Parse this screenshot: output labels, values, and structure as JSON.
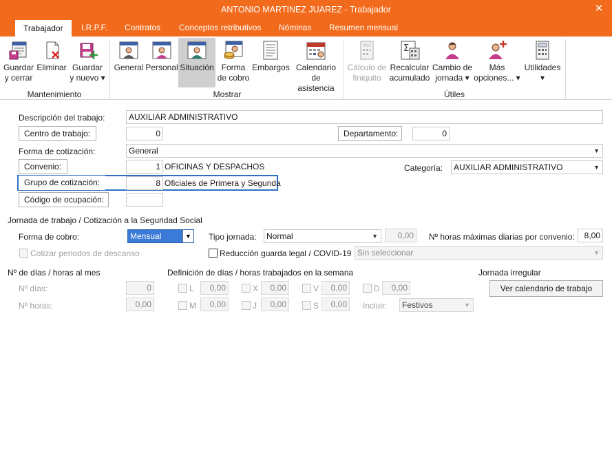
{
  "window": {
    "title": "ANTONIO MARTINEZ JUAREZ - Trabajador",
    "close_glyph": "✕"
  },
  "tabs": [
    "Trabajador",
    "I.R.P.F.",
    "Contratos",
    "Conceptos retributivos",
    "Nóminas",
    "Resumen mensual"
  ],
  "ribbon": {
    "buttons": [
      {
        "line1": "Guardar",
        "line2": "y cerrar",
        "icon": "save-close-icon"
      },
      {
        "line1": "Eliminar",
        "line2": "",
        "icon": "delete-icon"
      },
      {
        "line1": "Guardar",
        "line2": "y nuevo ▾",
        "icon": "save-new-icon"
      },
      {
        "line1": "General",
        "line2": "",
        "icon": "worker-general-icon"
      },
      {
        "line1": "Personal",
        "line2": "",
        "icon": "worker-personal-icon"
      },
      {
        "line1": "Situación",
        "line2": "",
        "icon": "worker-situation-icon"
      },
      {
        "line1": "Forma",
        "line2": "de cobro",
        "icon": "payment-method-icon"
      },
      {
        "line1": "Embargos",
        "line2": "",
        "icon": "seizures-icon"
      },
      {
        "line1": "Calendario",
        "line2": "de asistencia",
        "icon": "attendance-calendar-icon"
      },
      {
        "line1": "Cálculo de",
        "line2": "finiquito",
        "icon": "settlement-calc-icon"
      },
      {
        "line1": "Recalcular",
        "line2": "acumulado",
        "icon": "recalculate-icon"
      },
      {
        "line1": "Cambio de",
        "line2": "jornada ▾",
        "icon": "change-schedule-icon"
      },
      {
        "line1": "Más",
        "line2": "opciones... ▾",
        "icon": "more-options-icon"
      },
      {
        "line1": "Utilidades",
        "line2": "▾",
        "icon": "utilities-icon"
      }
    ],
    "groups": [
      "Mantenimiento",
      "Mostrar",
      "Útiles"
    ]
  },
  "form": {
    "descripcion_label": "Descripción del trabajo:",
    "descripcion_value": "AUXILIAR ADMINISTRATIVO",
    "centro_btn": "Centro de trabajo:",
    "centro_value": "0",
    "departamento_btn": "Departamento:",
    "departamento_value": "0",
    "forma_cot_label": "Forma de cotización:",
    "forma_cot_value": "General",
    "convenio_btn": "Convenio:",
    "convenio_code": "1",
    "convenio_name": "OFICINAS Y DESPACHOS",
    "categoria_label": "Categoría:",
    "categoria_value": "AUXILIAR ADMINISTRATIVO",
    "grupo_btn": "Grupo de cotización:",
    "grupo_code": "8",
    "grupo_name": "Oficiales de Primera y Segunda",
    "ocupacion_btn": "Código de ocupación:",
    "ocupacion_value": ""
  },
  "jornada": {
    "section_title": "Jornada de trabajo / Cotización a la Seguridad Social",
    "forma_cobro_label": "Forma de cobro:",
    "forma_cobro_value": "Mensual",
    "tipo_jornada_label": "Tipo jornada:",
    "tipo_jornada_value": "Normal",
    "tipo_jornada_num": "0,00",
    "max_horas_label": "Nº horas máximas diarias por convenio:",
    "max_horas_value": "8,00",
    "cotizar_label": "Cotizar periodos de descanso",
    "reduccion_label": "Reducción guarda legal / COVID-19",
    "reduccion_select": "Sin seleccionar"
  },
  "dias": {
    "section_title": "Nº de días / horas al mes",
    "dias_label": "Nº días:",
    "dias_value": "0",
    "horas_label": "Nº horas:",
    "horas_value": "0,00"
  },
  "semana": {
    "section_title": "Definición de días / horas trabajados en la semana",
    "days": [
      {
        "d": "L",
        "v": "0,00"
      },
      {
        "d": "X",
        "v": "0,00"
      },
      {
        "d": "V",
        "v": "0,00"
      },
      {
        "d": "D",
        "v": "0,00"
      },
      {
        "d": "M",
        "v": "0,00"
      },
      {
        "d": "J",
        "v": "0,00"
      },
      {
        "d": "S",
        "v": "0,00"
      }
    ],
    "incluir_label": "Incluir:",
    "incluir_value": "Festivos"
  },
  "irregular": {
    "section_title": "Jornada irregular",
    "calendar_btn": "Ver calendario de trabajo"
  }
}
